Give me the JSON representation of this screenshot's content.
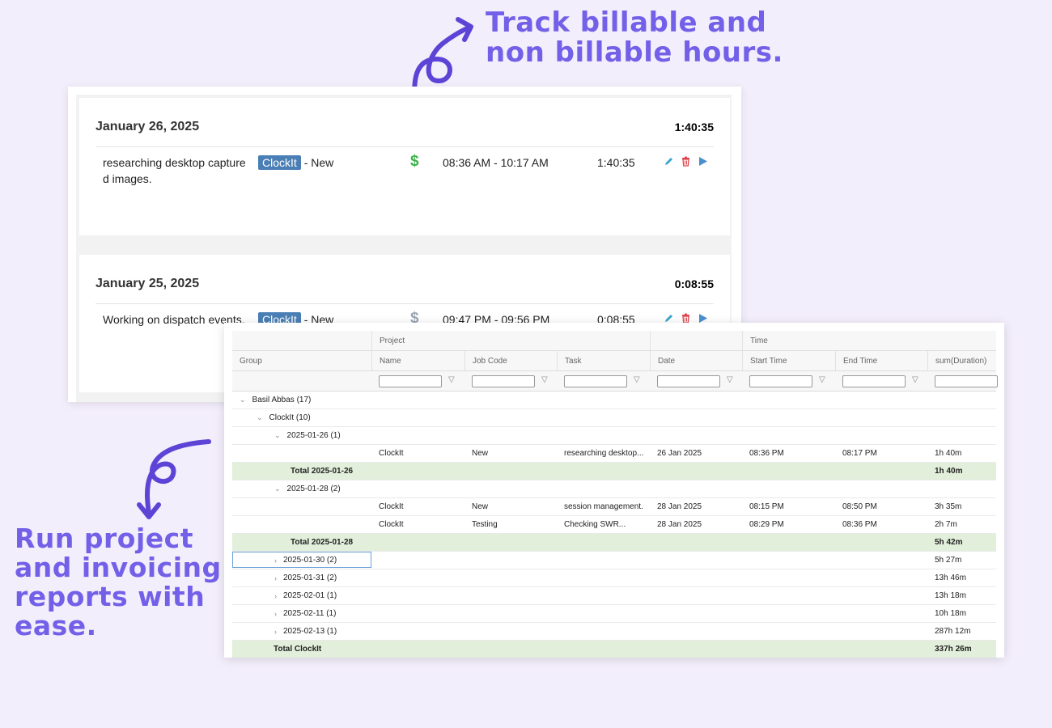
{
  "callouts": {
    "top": [
      "Track billable and",
      "non billable hours."
    ],
    "left": [
      "Run project",
      "and invoicing",
      "reports with",
      "ease."
    ]
  },
  "colors": {
    "accent": "#7360e8",
    "billable": "#3bb34a",
    "non_billable": "#9aa6b3",
    "tag": "#4a7fb5",
    "total_row": "#e2efdb"
  },
  "entries": {
    "days": [
      {
        "date": "January 26, 2025",
        "total": "1:40:35",
        "items": [
          {
            "description": "researching desktop captured images.",
            "project_tag": "ClockIt",
            "task": "- New",
            "billable": true,
            "billing_icon": "$",
            "range": "08:36 AM - 10:17 AM",
            "duration": "1:40:35"
          }
        ]
      },
      {
        "date": "January 25, 2025",
        "total": "0:08:55",
        "items": [
          {
            "description": "Working on dispatch events.",
            "project_tag": "ClockIt",
            "task": "- New",
            "billable": false,
            "billing_icon": "$",
            "range": "09:47 PM - 09:56 PM",
            "duration": "0:08:55"
          }
        ]
      }
    ],
    "action_icons": [
      "pencil-icon",
      "trash-icon",
      "play-icon"
    ]
  },
  "report": {
    "group_headers": {
      "project": "Project",
      "time": "Time"
    },
    "columns": [
      "Group",
      "Name",
      "Job Code",
      "Task",
      "Date",
      "Start Time",
      "End Time",
      "sum(Duration)"
    ],
    "filter_icon": "▽",
    "rows": [
      {
        "type": "group",
        "level": 0,
        "expanded": true,
        "label": "Basil Abbas (17)"
      },
      {
        "type": "group",
        "level": 1,
        "expanded": true,
        "label": "ClockIt (10)"
      },
      {
        "type": "group",
        "level": 2,
        "expanded": true,
        "label": "2025-01-26 (1)"
      },
      {
        "type": "data",
        "name": "ClockIt",
        "job_code": "New",
        "task": "researching desktop...",
        "date": "26 Jan 2025",
        "start": "08:36 PM",
        "end": "08:17 PM",
        "duration": "1h 40m"
      },
      {
        "type": "total",
        "level": 2,
        "label": "Total 2025-01-26",
        "duration": "1h 40m"
      },
      {
        "type": "group",
        "level": 2,
        "expanded": true,
        "label": "2025-01-28 (2)"
      },
      {
        "type": "data",
        "name": "ClockIt",
        "job_code": "New",
        "task": "session management.",
        "date": "28 Jan 2025",
        "start": "08:15 PM",
        "end": "08:50 PM",
        "duration": "3h 35m"
      },
      {
        "type": "data",
        "name": "ClockIt",
        "job_code": "Testing",
        "task": "Checking SWR...",
        "date": "28 Jan 2025",
        "start": "08:29 PM",
        "end": "08:36 PM",
        "duration": "2h 7m"
      },
      {
        "type": "total",
        "level": 2,
        "label": "Total 2025-01-28",
        "duration": "5h 42m"
      },
      {
        "type": "group",
        "level": 2,
        "expanded": false,
        "label": "2025-01-30 (2)",
        "duration": "5h 27m",
        "selected": true
      },
      {
        "type": "group",
        "level": 2,
        "expanded": false,
        "label": "2025-01-31 (2)",
        "duration": "13h 46m"
      },
      {
        "type": "group",
        "level": 2,
        "expanded": false,
        "label": "2025-02-01 (1)",
        "duration": "13h 18m"
      },
      {
        "type": "group",
        "level": 2,
        "expanded": false,
        "label": "2025-02-11 (1)",
        "duration": "10h 18m"
      },
      {
        "type": "group",
        "level": 2,
        "expanded": false,
        "label": "2025-02-13 (1)",
        "duration": "287h 12m"
      },
      {
        "type": "total",
        "level": 1,
        "label": "Total ClockIt",
        "duration": "337h 26m"
      }
    ]
  }
}
